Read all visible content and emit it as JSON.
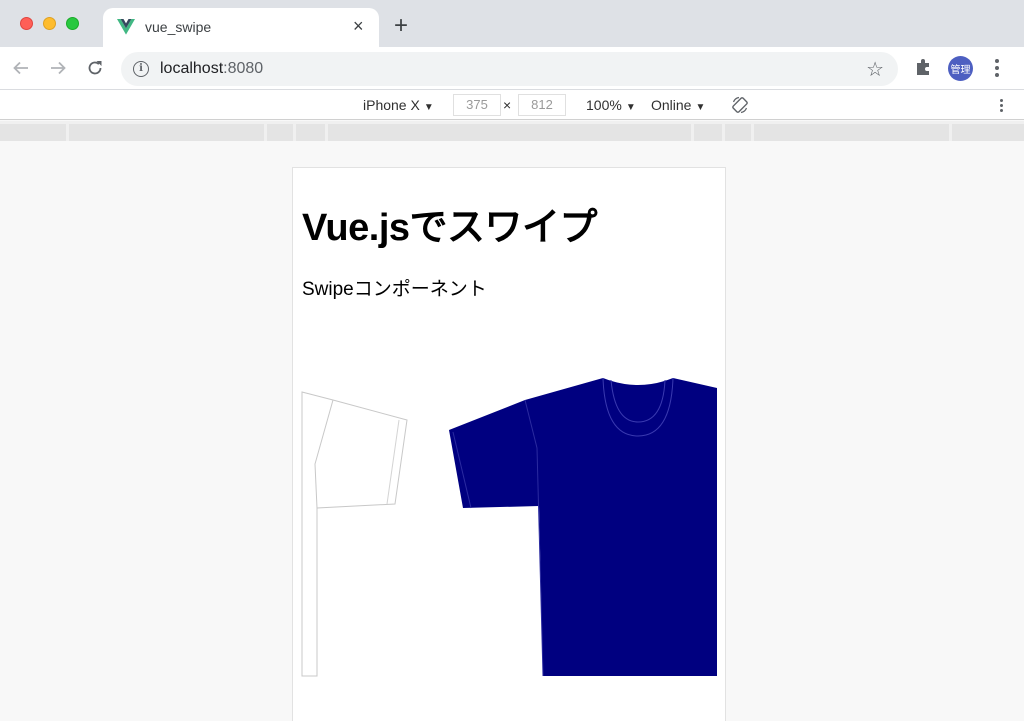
{
  "browser": {
    "tab": {
      "title": "vue_swipe",
      "close": "×"
    },
    "new_tab": "+",
    "url": {
      "host": "localhost",
      "port": ":8080"
    },
    "avatar_label": "管理"
  },
  "devtools": {
    "device": "iPhone X",
    "width": "375",
    "height": "812",
    "times": "×",
    "zoom": "100%",
    "network": "Online",
    "caret": "▼"
  },
  "page": {
    "title": "Vue.jsでスワイプ",
    "subtitle": "Swipeコンポーネント"
  },
  "colors": {
    "shirt_navy": "#000080",
    "shirt_white": "#ffffff",
    "vue_green": "#41b883",
    "vue_dark": "#35495e"
  }
}
